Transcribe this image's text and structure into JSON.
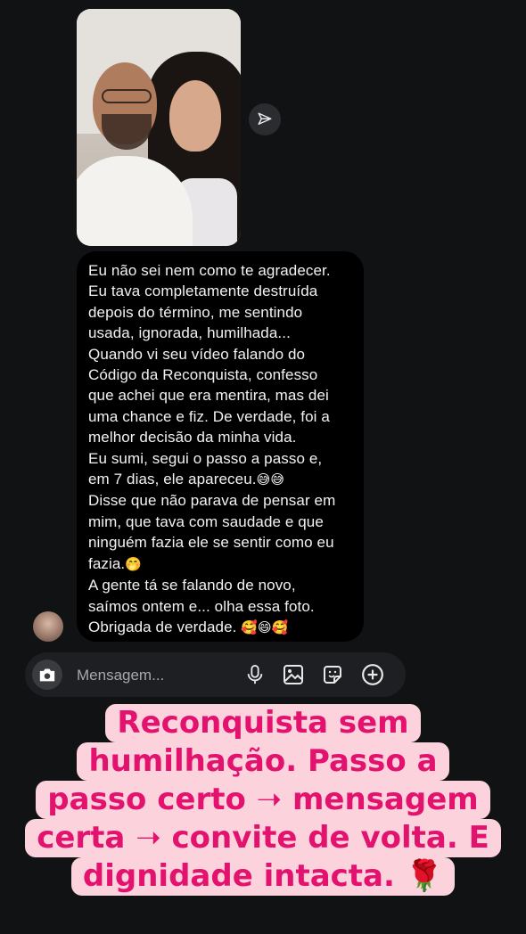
{
  "message": {
    "lines": [
      "Eu não sei nem como te agradecer.",
      "Eu tava completamente destruída",
      "depois do término, me sentindo",
      "usada, ignorada, humilhada...",
      "Quando vi seu vídeo falando do",
      "Código da Reconquista, confesso",
      "que achei que era mentira, mas dei",
      "uma chance e fiz. De verdade, foi a",
      "melhor decisão da minha vida.",
      "Eu sumi, segui o passo a passo e,",
      "em 7 dias, ele apareceu.",
      "Disse que não parava de pensar em",
      "mim, que tava com saudade e que",
      "ninguém fazia ele se sentir como eu",
      "fazia.",
      "A gente tá se falando de novo,",
      "saímos ontem e... olha essa foto.",
      "Obrigada de verdade."
    ],
    "emoji_after_apareceu": "😅😅",
    "emoji_after_fazia": "🤭",
    "emoji_after_obrigada": "🥰😄🥰"
  },
  "composer": {
    "placeholder": "Mensagem..."
  },
  "icons": {
    "share": "send-icon",
    "camera": "camera-icon",
    "mic": "microphone-icon",
    "gallery": "image-icon",
    "sticker": "sticker-icon",
    "add": "plus-circle-icon"
  },
  "caption": {
    "lines": [
      "Reconquista sem",
      "humilhação. Passo a",
      "passo certo ➝ mensagem",
      "certa ➝ convite de volta. E",
      "dignidade intacta."
    ],
    "emoji": "🌹"
  },
  "colors": {
    "background": "#111214",
    "bubble": "#000000",
    "caption_text": "#e3126f",
    "caption_bg": "#fcd3dc"
  }
}
